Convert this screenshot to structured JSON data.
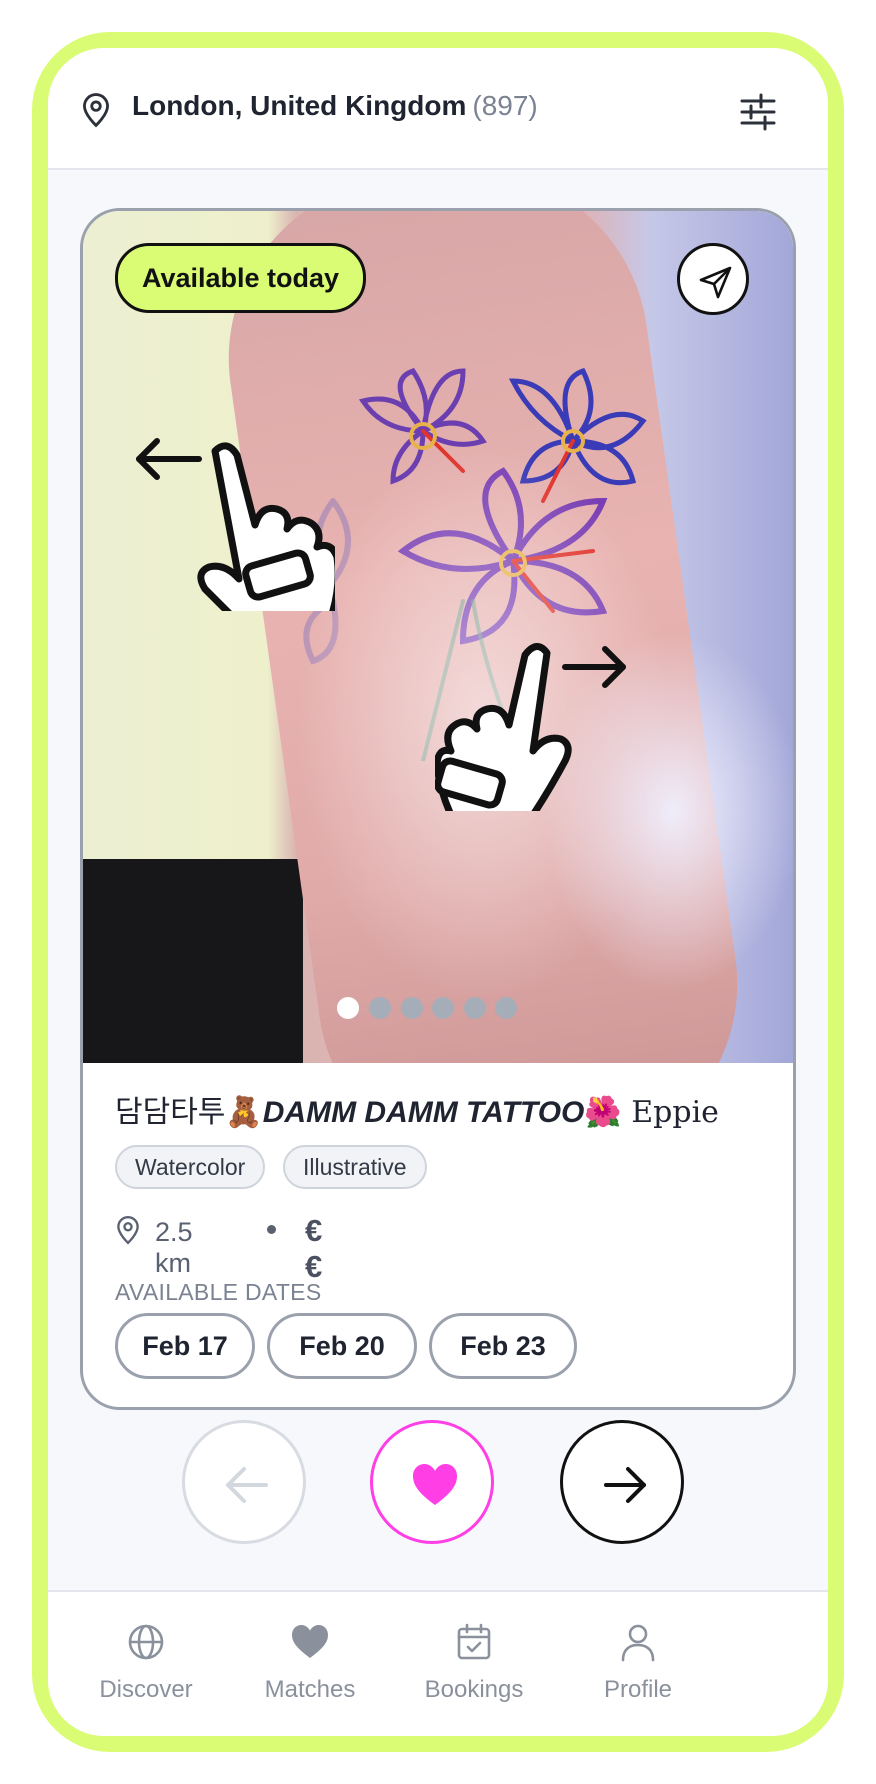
{
  "header": {
    "location": "London, United Kingdom",
    "count": "(897)",
    "location_icon": "map-pin-icon",
    "filter_icon": "sliders-icon"
  },
  "card": {
    "availability_badge": "Available today",
    "share_icon": "send-icon",
    "photo_count": 6,
    "active_photo": 1,
    "artist": {
      "name_korean": "담담타투",
      "emoji_1": "🧸",
      "name_brand": "DAMM DAMM TATTOO",
      "emoji_2": "🌺",
      "name_person": " Eppie"
    },
    "tags": [
      "Watercolor",
      "Illustrative"
    ],
    "distance": "2.5 km",
    "price": "€€",
    "available_dates_label": "AVAILABLE DATES",
    "dates": [
      "Feb 17",
      "Feb 20",
      "Feb 23"
    ]
  },
  "actions": {
    "back_icon": "arrow-left-icon",
    "like_icon": "heart-icon",
    "next_icon": "arrow-right-icon"
  },
  "nav": [
    {
      "label": "Discover",
      "icon": "globe-icon"
    },
    {
      "label": "Matches",
      "icon": "heart-icon"
    },
    {
      "label": "Bookings",
      "icon": "calendar-check-icon"
    },
    {
      "label": "Profile",
      "icon": "user-icon"
    }
  ],
  "colors": {
    "accent_lime": "#dafc75",
    "like_pink": "#ff3ee6",
    "nav_gray": "#8b919c"
  }
}
